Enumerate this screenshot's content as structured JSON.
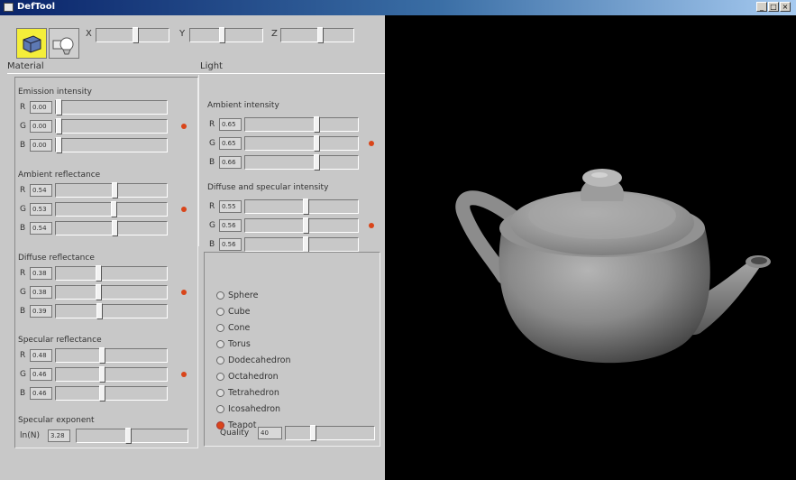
{
  "window": {
    "title": "DefTool",
    "controls": [
      "_",
      "□",
      "×"
    ]
  },
  "toolbar": {
    "material_tool_icon": "material-object-icon",
    "light_tool_icon": "light-bulb-icon",
    "axes": [
      {
        "label": "X",
        "level": 0.55
      },
      {
        "label": "Y",
        "level": 0.45
      },
      {
        "label": "Z",
        "level": 0.55
      }
    ]
  },
  "material": {
    "title": "Material",
    "groups": [
      {
        "label": "Emission intensity",
        "rows": [
          {
            "ch": "R",
            "value": "0.00",
            "level": 0.0
          },
          {
            "ch": "G",
            "value": "0.00",
            "level": 0.0
          },
          {
            "ch": "B",
            "value": "0.00",
            "level": 0.0
          }
        ]
      },
      {
        "label": "Ambient reflectance",
        "rows": [
          {
            "ch": "R",
            "value": "0.54",
            "level": 0.54
          },
          {
            "ch": "G",
            "value": "0.53",
            "level": 0.53
          },
          {
            "ch": "B",
            "value": "0.54",
            "level": 0.54
          }
        ]
      },
      {
        "label": "Diffuse reflectance",
        "rows": [
          {
            "ch": "R",
            "value": "0.38",
            "level": 0.38
          },
          {
            "ch": "G",
            "value": "0.38",
            "level": 0.38
          },
          {
            "ch": "B",
            "value": "0.39",
            "level": 0.39
          }
        ]
      },
      {
        "label": "Specular reflectance",
        "rows": [
          {
            "ch": "R",
            "value": "0.48",
            "level": 0.42
          },
          {
            "ch": "G",
            "value": "0.46",
            "level": 0.42
          },
          {
            "ch": "B",
            "value": "0.46",
            "level": 0.42
          }
        ]
      }
    ],
    "exponent": {
      "label": "Specular exponent",
      "ch": "ln(N)",
      "value": "3.28",
      "level": 0.47
    }
  },
  "light": {
    "title": "Light",
    "groups": [
      {
        "label": "Ambient intensity",
        "rows": [
          {
            "ch": "R",
            "value": "0.65",
            "level": 0.65
          },
          {
            "ch": "G",
            "value": "0.65",
            "level": 0.65
          },
          {
            "ch": "B",
            "value": "0.66",
            "level": 0.65
          }
        ]
      },
      {
        "label": "Diffuse and specular intensity",
        "rows": [
          {
            "ch": "R",
            "value": "0.55",
            "level": 0.55
          },
          {
            "ch": "G",
            "value": "0.56",
            "level": 0.55
          },
          {
            "ch": "B",
            "value": "0.56",
            "level": 0.55
          }
        ]
      }
    ]
  },
  "shapes": {
    "options": [
      "Sphere",
      "Cube",
      "Cone",
      "Torus",
      "Dodecahedron",
      "Octahedron",
      "Tetrahedron",
      "Icosahedron",
      "Teapot"
    ],
    "selected": "Teapot"
  },
  "quality": {
    "label": "Quality",
    "value": "40",
    "level": 0.3
  },
  "colors": {
    "accent_dot": "#d9451a",
    "active_tool": "#f4ee3a",
    "viewport_bg": "#000000"
  }
}
